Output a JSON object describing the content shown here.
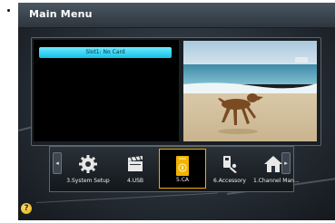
{
  "header": {
    "title": "Main Menu"
  },
  "slot_status": "Slot1: No Card",
  "menu": {
    "items": [
      {
        "label": "3.System Setup",
        "icon": "gear-icon"
      },
      {
        "label": "4.USB",
        "icon": "clapperboard-icon"
      },
      {
        "label": "5.CA",
        "icon": "ca-card-icon",
        "selected": true
      },
      {
        "label": "6.Accessory",
        "icon": "tools-icon"
      },
      {
        "label": "1.Channel Man...",
        "icon": "house-icon"
      }
    ],
    "left_arrow": "◂",
    "right_arrow": "▸"
  },
  "help_icon": "?",
  "colors": {
    "selection_border": "#f2a900",
    "slot_bar": "#12c2e6",
    "background": "#262d35"
  }
}
